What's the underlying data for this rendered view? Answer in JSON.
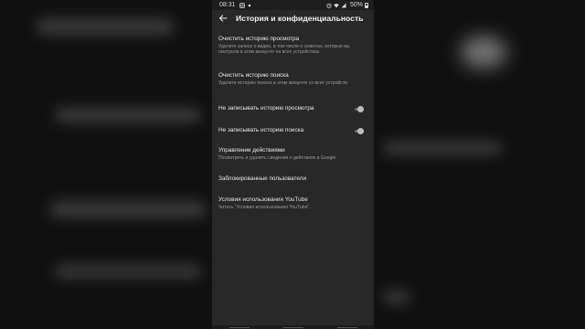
{
  "status_bar": {
    "time": "08:31",
    "battery": "50%"
  },
  "app_bar": {
    "title": "История и конфиденциальность",
    "back_icon": "arrow-left-icon"
  },
  "settings": [
    {
      "title": "Очистить историю просмотра",
      "subtitle": "Удалите записи о видео, в том числе о сюжетах, которые вы смотрели в этом аккаунте на всех устройствах.",
      "toggle": null
    },
    {
      "title": "Очистить историю поиска",
      "subtitle": "Удалите историю поиска в этом аккаунте со всех устройств.",
      "toggle": null
    },
    {
      "title": "Не записывать историю просмотра",
      "subtitle": "",
      "toggle": false
    },
    {
      "title": "Не записывать историю поиска",
      "subtitle": "",
      "toggle": false
    },
    {
      "title": "Управление действиями",
      "subtitle": "Посмотреть и удалить сведения о действиях в Google",
      "toggle": null
    },
    {
      "title": "Заблокированные пользователи",
      "subtitle": "",
      "toggle": null
    },
    {
      "title": "Условия использования YouTube",
      "subtitle": "Читать \"Условия использования YouTube\".",
      "toggle": null
    }
  ],
  "colors": {
    "background": "#282828",
    "text_primary": "#e9e9e9",
    "text_secondary": "#9a9a9a"
  }
}
